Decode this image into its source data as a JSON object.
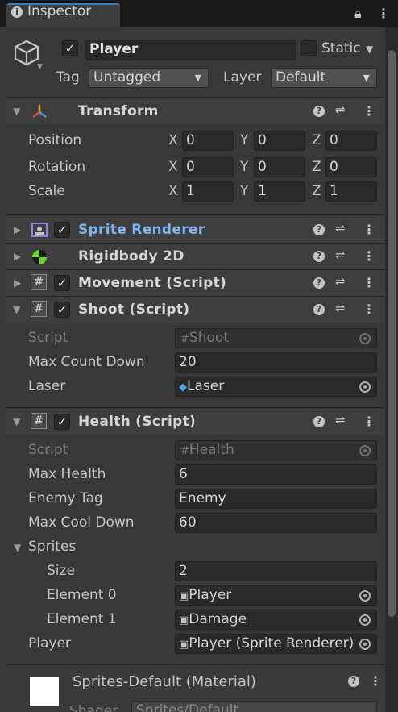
{
  "tab": {
    "title": "Inspector"
  },
  "object": {
    "name": "Player",
    "active": true,
    "static_label": "Static",
    "tag_label": "Tag",
    "tag_value": "Untagged",
    "layer_label": "Layer",
    "layer_value": "Default"
  },
  "transform": {
    "title": "Transform",
    "rows": [
      {
        "label": "Position",
        "x": "0",
        "y": "0",
        "z": "0"
      },
      {
        "label": "Rotation",
        "x": "0",
        "y": "0",
        "z": "0"
      },
      {
        "label": "Scale",
        "x": "1",
        "y": "1",
        "z": "1"
      }
    ],
    "axis_x": "X",
    "axis_y": "Y",
    "axis_z": "Z"
  },
  "components": {
    "sprite_renderer": {
      "title": "Sprite Renderer",
      "enabled": true
    },
    "rigidbody": {
      "title": "Rigidbody 2D"
    },
    "movement": {
      "title": "Movement (Script)",
      "enabled": true
    },
    "shoot": {
      "title": "Shoot (Script)",
      "enabled": true,
      "script_label": "Script",
      "script_value": "Shoot",
      "count_label": "Max Count Down",
      "count_value": "20",
      "laser_label": "Laser",
      "laser_value": "Laser"
    },
    "health": {
      "title": "Health (Script)",
      "enabled": true,
      "script_label": "Script",
      "script_value": "Health",
      "max_health_label": "Max Health",
      "max_health_value": "6",
      "enemy_tag_label": "Enemy Tag",
      "enemy_tag_value": "Enemy",
      "cool_label": "Max Cool Down",
      "cool_value": "60",
      "sprites_label": "Sprites",
      "size_label": "Size",
      "size_value": "2",
      "el0_label": "Element 0",
      "el0_value": "Player",
      "el1_label": "Element 1",
      "el1_value": "Damage",
      "player_label": "Player",
      "player_value": "Player (Sprite Renderer)"
    }
  },
  "material": {
    "title": "Sprites-Default (Material)",
    "shader_label": "Shader",
    "shader_value": "Sprites/Default"
  },
  "colors": {
    "accent_blue": "#3a79bb",
    "sprite_title_blue": "#7fb4f0",
    "panel": "#383838",
    "header": "#3e3e3e"
  }
}
